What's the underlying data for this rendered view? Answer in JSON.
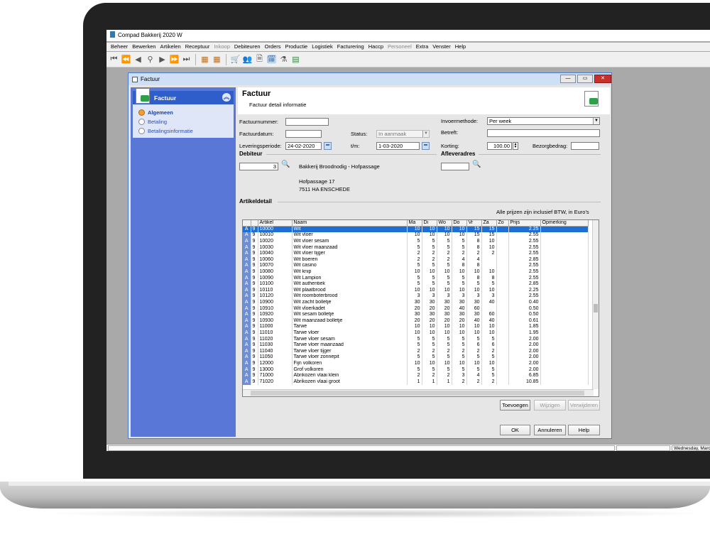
{
  "app": {
    "title": "Compad Bakkerij 2020 W",
    "menu": [
      {
        "label": "Beheer",
        "disabled": false
      },
      {
        "label": "Bewerken",
        "disabled": false
      },
      {
        "label": "Artikelen",
        "disabled": false
      },
      {
        "label": "Receptuur",
        "disabled": false
      },
      {
        "label": "Inkoop",
        "disabled": true
      },
      {
        "label": "Debiteuren",
        "disabled": false
      },
      {
        "label": "Orders",
        "disabled": false
      },
      {
        "label": "Productie",
        "disabled": false
      },
      {
        "label": "Logistiek",
        "disabled": false
      },
      {
        "label": "Facturering",
        "disabled": false
      },
      {
        "label": "Haccp",
        "disabled": false
      },
      {
        "label": "Personeel",
        "disabled": true
      },
      {
        "label": "Extra",
        "disabled": false
      },
      {
        "label": "Venster",
        "disabled": false
      },
      {
        "label": "Help",
        "disabled": false
      }
    ],
    "statusbar": {
      "date": "Wednesday, Marc"
    }
  },
  "dialog": {
    "title": "Factuur",
    "header": {
      "title": "Factuur",
      "subtitle": "Factuur detail informatie"
    },
    "sidebar": {
      "title": "Factuur",
      "items": [
        {
          "label": "Algemeen",
          "selected": true
        },
        {
          "label": "Betaling",
          "selected": false
        },
        {
          "label": "Betalingsinformatie",
          "selected": false
        }
      ]
    },
    "form": {
      "factuurnummer_label": "Factuurnummer:",
      "factuurnummer": "",
      "factuurdatum_label": "Factuurdatum:",
      "factuurdatum": "",
      "status_label": "Status:",
      "status": "In aanmaak",
      "leveringsperiode_label": "Leveringsperiode:",
      "leveringsperiode_from": "24-02-2020",
      "tm_label": "t/m:",
      "leveringsperiode_to": "1-03-2020",
      "invoermethode_label": "Invoermethode:",
      "invoermethode": "Per week",
      "betreft_label": "Betreft:",
      "betreft": "",
      "korting_label": "Korting:",
      "korting": "100.00",
      "bezorgbedrag_label": "Bezorgbedrag:",
      "bezorgbedrag": ""
    },
    "debiteur": {
      "section_title": "Debiteur",
      "number": "3",
      "name": "Bakkerij Broodnodig - Hofpassage",
      "street": "Hofpassage 17",
      "postal_city": "7511 HA   ENSCHEDE"
    },
    "afleveradres": {
      "section_title": "Afleveradres",
      "value": ""
    },
    "artikeldetail": {
      "section_title": "Artikeldetail",
      "note": "Alle prijzen zijn inclusief BTW, in Euro's",
      "columns": [
        "",
        "",
        "Artikel",
        "Naam",
        "Ma",
        "Di",
        "Wo",
        "Do",
        "Vr",
        "Za",
        "Zo",
        "Prijs",
        "Opmerking"
      ],
      "rows": [
        [
          "A",
          "9",
          "10000",
          "Wit",
          "10",
          "10",
          "10",
          "10",
          "15",
          "15",
          "",
          "2.25",
          ""
        ],
        [
          "A",
          "9",
          "10010",
          "Wit vloer",
          "10",
          "10",
          "10",
          "10",
          "15",
          "15",
          "",
          "2.55",
          ""
        ],
        [
          "A",
          "9",
          "10020",
          "Wit vloer sesam",
          "5",
          "5",
          "5",
          "5",
          "8",
          "10",
          "",
          "2.55",
          ""
        ],
        [
          "A",
          "9",
          "10030",
          "Wit vloer maanzaad",
          "5",
          "5",
          "5",
          "5",
          "8",
          "10",
          "",
          "2.55",
          ""
        ],
        [
          "A",
          "9",
          "10040",
          "Wit vloer tijger",
          "2",
          "2",
          "2",
          "2",
          "2",
          "2",
          "",
          "2.55",
          ""
        ],
        [
          "A",
          "9",
          "10060",
          "Wit boeren",
          "2",
          "2",
          "2",
          "4",
          "4",
          "",
          "",
          "2.85",
          ""
        ],
        [
          "A",
          "9",
          "10070",
          "Wit casino",
          "5",
          "5",
          "5",
          "8",
          "8",
          "",
          "",
          "2.55",
          ""
        ],
        [
          "A",
          "9",
          "10080",
          "Wit knip",
          "10",
          "10",
          "10",
          "10",
          "10",
          "10",
          "",
          "2.55",
          ""
        ],
        [
          "A",
          "9",
          "10090",
          "Wit Lampion",
          "5",
          "5",
          "5",
          "5",
          "8",
          "8",
          "",
          "2.55",
          ""
        ],
        [
          "A",
          "9",
          "10100",
          "Wit authentiek",
          "5",
          "5",
          "5",
          "5",
          "5",
          "5",
          "",
          "2.85",
          ""
        ],
        [
          "A",
          "9",
          "10110",
          "Wit plaatbrood",
          "10",
          "10",
          "10",
          "10",
          "10",
          "10",
          "",
          "2.25",
          ""
        ],
        [
          "A",
          "9",
          "10120",
          "Wit roomboterbrood",
          "3",
          "3",
          "3",
          "3",
          "3",
          "3",
          "",
          "2.55",
          ""
        ],
        [
          "A",
          "9",
          "10900",
          "Wit zacht bolletje",
          "30",
          "30",
          "30",
          "30",
          "30",
          "40",
          "",
          "0.40",
          ""
        ],
        [
          "A",
          "9",
          "10910",
          "Wit vloerkadet",
          "20",
          "20",
          "20",
          "40",
          "60",
          "",
          "",
          "0.50",
          ""
        ],
        [
          "A",
          "9",
          "10920",
          "Wit sesam bolletje",
          "30",
          "30",
          "30",
          "30",
          "30",
          "60",
          "",
          "0.50",
          ""
        ],
        [
          "A",
          "9",
          "10930",
          "Wit maanzaad bolletje",
          "20",
          "20",
          "20",
          "20",
          "40",
          "40",
          "",
          "0.61",
          ""
        ],
        [
          "A",
          "9",
          "11000",
          "Tarwe",
          "10",
          "10",
          "10",
          "10",
          "10",
          "10",
          "",
          "1.85",
          ""
        ],
        [
          "A",
          "9",
          "11010",
          "Tarwe vloer",
          "10",
          "10",
          "10",
          "10",
          "10",
          "10",
          "",
          "1.95",
          ""
        ],
        [
          "A",
          "9",
          "11020",
          "Tarwe vloer sesam",
          "5",
          "5",
          "5",
          "5",
          "5",
          "5",
          "",
          "2.00",
          ""
        ],
        [
          "A",
          "9",
          "11030",
          "Tarwe vloer maanzaad",
          "5",
          "5",
          "5",
          "5",
          "6",
          "6",
          "",
          "2.00",
          ""
        ],
        [
          "A",
          "9",
          "11040",
          "Tarwe vloer tijger",
          "2",
          "2",
          "2",
          "2",
          "2",
          "2",
          "",
          "2.00",
          ""
        ],
        [
          "A",
          "9",
          "11050",
          "Tarwe vloer zonnepit",
          "5",
          "5",
          "5",
          "5",
          "5",
          "5",
          "",
          "2.00",
          ""
        ],
        [
          "A",
          "9",
          "12000",
          "Fijn volkoren",
          "10",
          "10",
          "10",
          "10",
          "10",
          "10",
          "",
          "2.00",
          ""
        ],
        [
          "A",
          "9",
          "13000",
          "Grof volkoren",
          "5",
          "5",
          "5",
          "5",
          "5",
          "5",
          "",
          "2.00",
          ""
        ],
        [
          "A",
          "9",
          "71000",
          "Abrikozen vlaai klein",
          "2",
          "2",
          "2",
          "3",
          "4",
          "5",
          "",
          "6.85",
          ""
        ],
        [
          "A",
          "9",
          "71020",
          "Abrikozen vlaai groot",
          "1",
          "1",
          "1",
          "2",
          "2",
          "2",
          "",
          "10.85",
          ""
        ]
      ]
    },
    "buttons": {
      "toevoegen": "Toevoegen",
      "wijzigen": "Wijzigen",
      "verwijderen": "Verwijderen",
      "ok": "OK",
      "annuleren": "Annuleren",
      "help": "Help"
    }
  }
}
